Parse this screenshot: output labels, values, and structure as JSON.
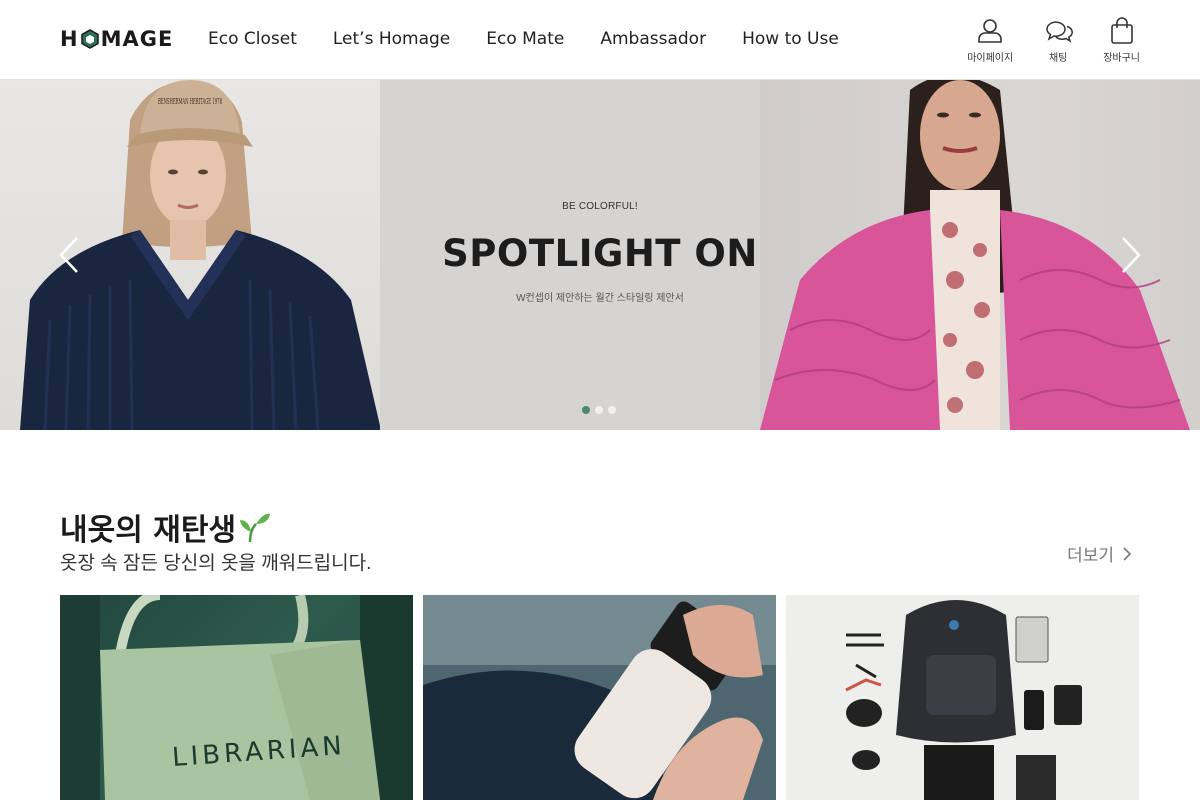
{
  "header": {
    "logo_text": {
      "left": "H",
      "right": "MAGE"
    },
    "nav": [
      "Eco Closet",
      "Let’s Homage",
      "Eco Mate",
      "Ambassador",
      "How to Use"
    ],
    "utils": [
      {
        "label": "마이페이지",
        "icon": "user-icon"
      },
      {
        "label": "채팅",
        "icon": "chat-icon"
      },
      {
        "label": "장바구니",
        "icon": "shopping-bag-icon"
      }
    ]
  },
  "banner": {
    "small_text": "BE COLORFUL!",
    "title": "SPOTLIGHT ON",
    "subtitle": "W컨셉이 제안하는 월간 스타일링 제안서",
    "slide_count": 3,
    "active_slide": 1,
    "left_cap_text": "BENSHERMAN HERITAGE 1978"
  },
  "section": {
    "title": "내옷의 재탄생",
    "subtitle": "옷장 속 잠든 당신의 옷을 깨워드립니다.",
    "more_label": "더보기",
    "cards": [
      {
        "label": "LIBRARIAN",
        "alt": "tote bag"
      },
      {
        "label": "",
        "alt": "water bottle"
      },
      {
        "label": "",
        "alt": "backpack flat lay"
      }
    ]
  },
  "colors": {
    "accent": "#4b8a6d",
    "text": "#222222",
    "muted": "#777777",
    "border": "#e2e2e2"
  }
}
